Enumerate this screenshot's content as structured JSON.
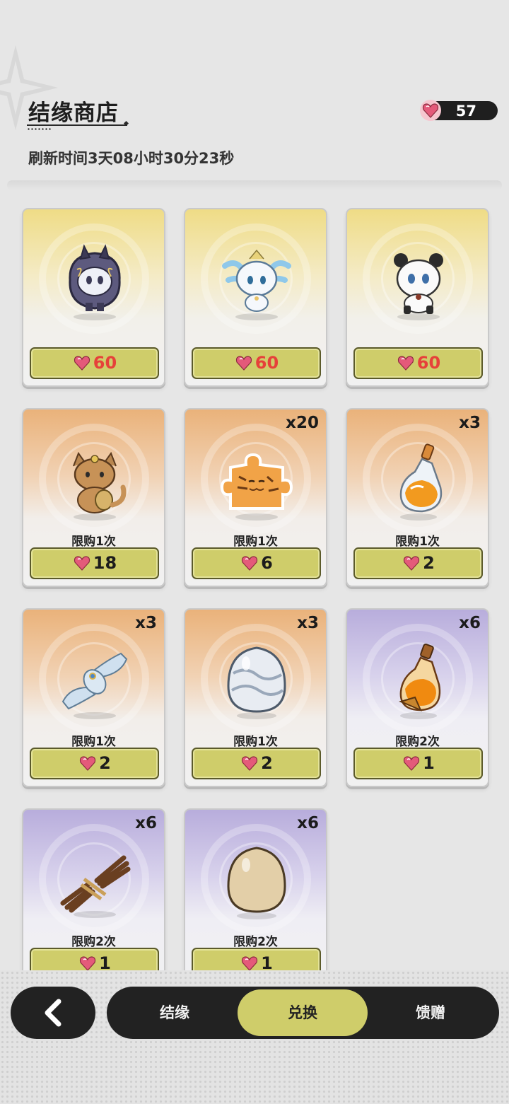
{
  "header": {
    "title": "结缘商店",
    "refresh_text": "刷新时间3天08小时30分23秒",
    "currency_amount": "57",
    "currency_icon": "heart-gem-icon"
  },
  "colors": {
    "price_button": "#cfcd6a",
    "price_text_red": "#e6413a",
    "dark_bar": "#222222",
    "active_tab": "#cfcd6a"
  },
  "items": [
    {
      "name": "dark-spirit-pet",
      "rarity": "gold",
      "qty": "",
      "limit": "",
      "price": "60"
    },
    {
      "name": "ice-dragon-pet",
      "rarity": "gold",
      "qty": "",
      "limit": "",
      "price": "60"
    },
    {
      "name": "panda-pet",
      "rarity": "gold",
      "qty": "",
      "limit": "",
      "price": "60"
    },
    {
      "name": "lucky-dog-pet",
      "rarity": "orange",
      "qty": "",
      "limit": "限购1次",
      "price": "18"
    },
    {
      "name": "tiger-puzzle-piece",
      "rarity": "orange",
      "qty": "x20",
      "limit": "限购1次",
      "price": "6"
    },
    {
      "name": "orange-potion-bottle",
      "rarity": "orange",
      "qty": "x3",
      "limit": "限购1次",
      "price": "2"
    },
    {
      "name": "cloth-scroll",
      "rarity": "orange",
      "qty": "x3",
      "limit": "限购1次",
      "price": "2"
    },
    {
      "name": "silver-egg",
      "rarity": "orange",
      "qty": "x3",
      "limit": "限购1次",
      "price": "2"
    },
    {
      "name": "amber-potion-bottle",
      "rarity": "purple",
      "qty": "x6",
      "limit": "限购2次",
      "price": "1"
    },
    {
      "name": "twig-bundle",
      "rarity": "purple",
      "qty": "x6",
      "limit": "限购2次",
      "price": "1"
    },
    {
      "name": "plain-egg",
      "rarity": "purple",
      "qty": "x6",
      "limit": "限购2次",
      "price": "1"
    }
  ],
  "nav": {
    "back_icon": "chevron-left-icon",
    "tabs": [
      {
        "label": "结缘",
        "active": false
      },
      {
        "label": "兑换",
        "active": true
      },
      {
        "label": "馈赠",
        "active": false
      }
    ]
  }
}
